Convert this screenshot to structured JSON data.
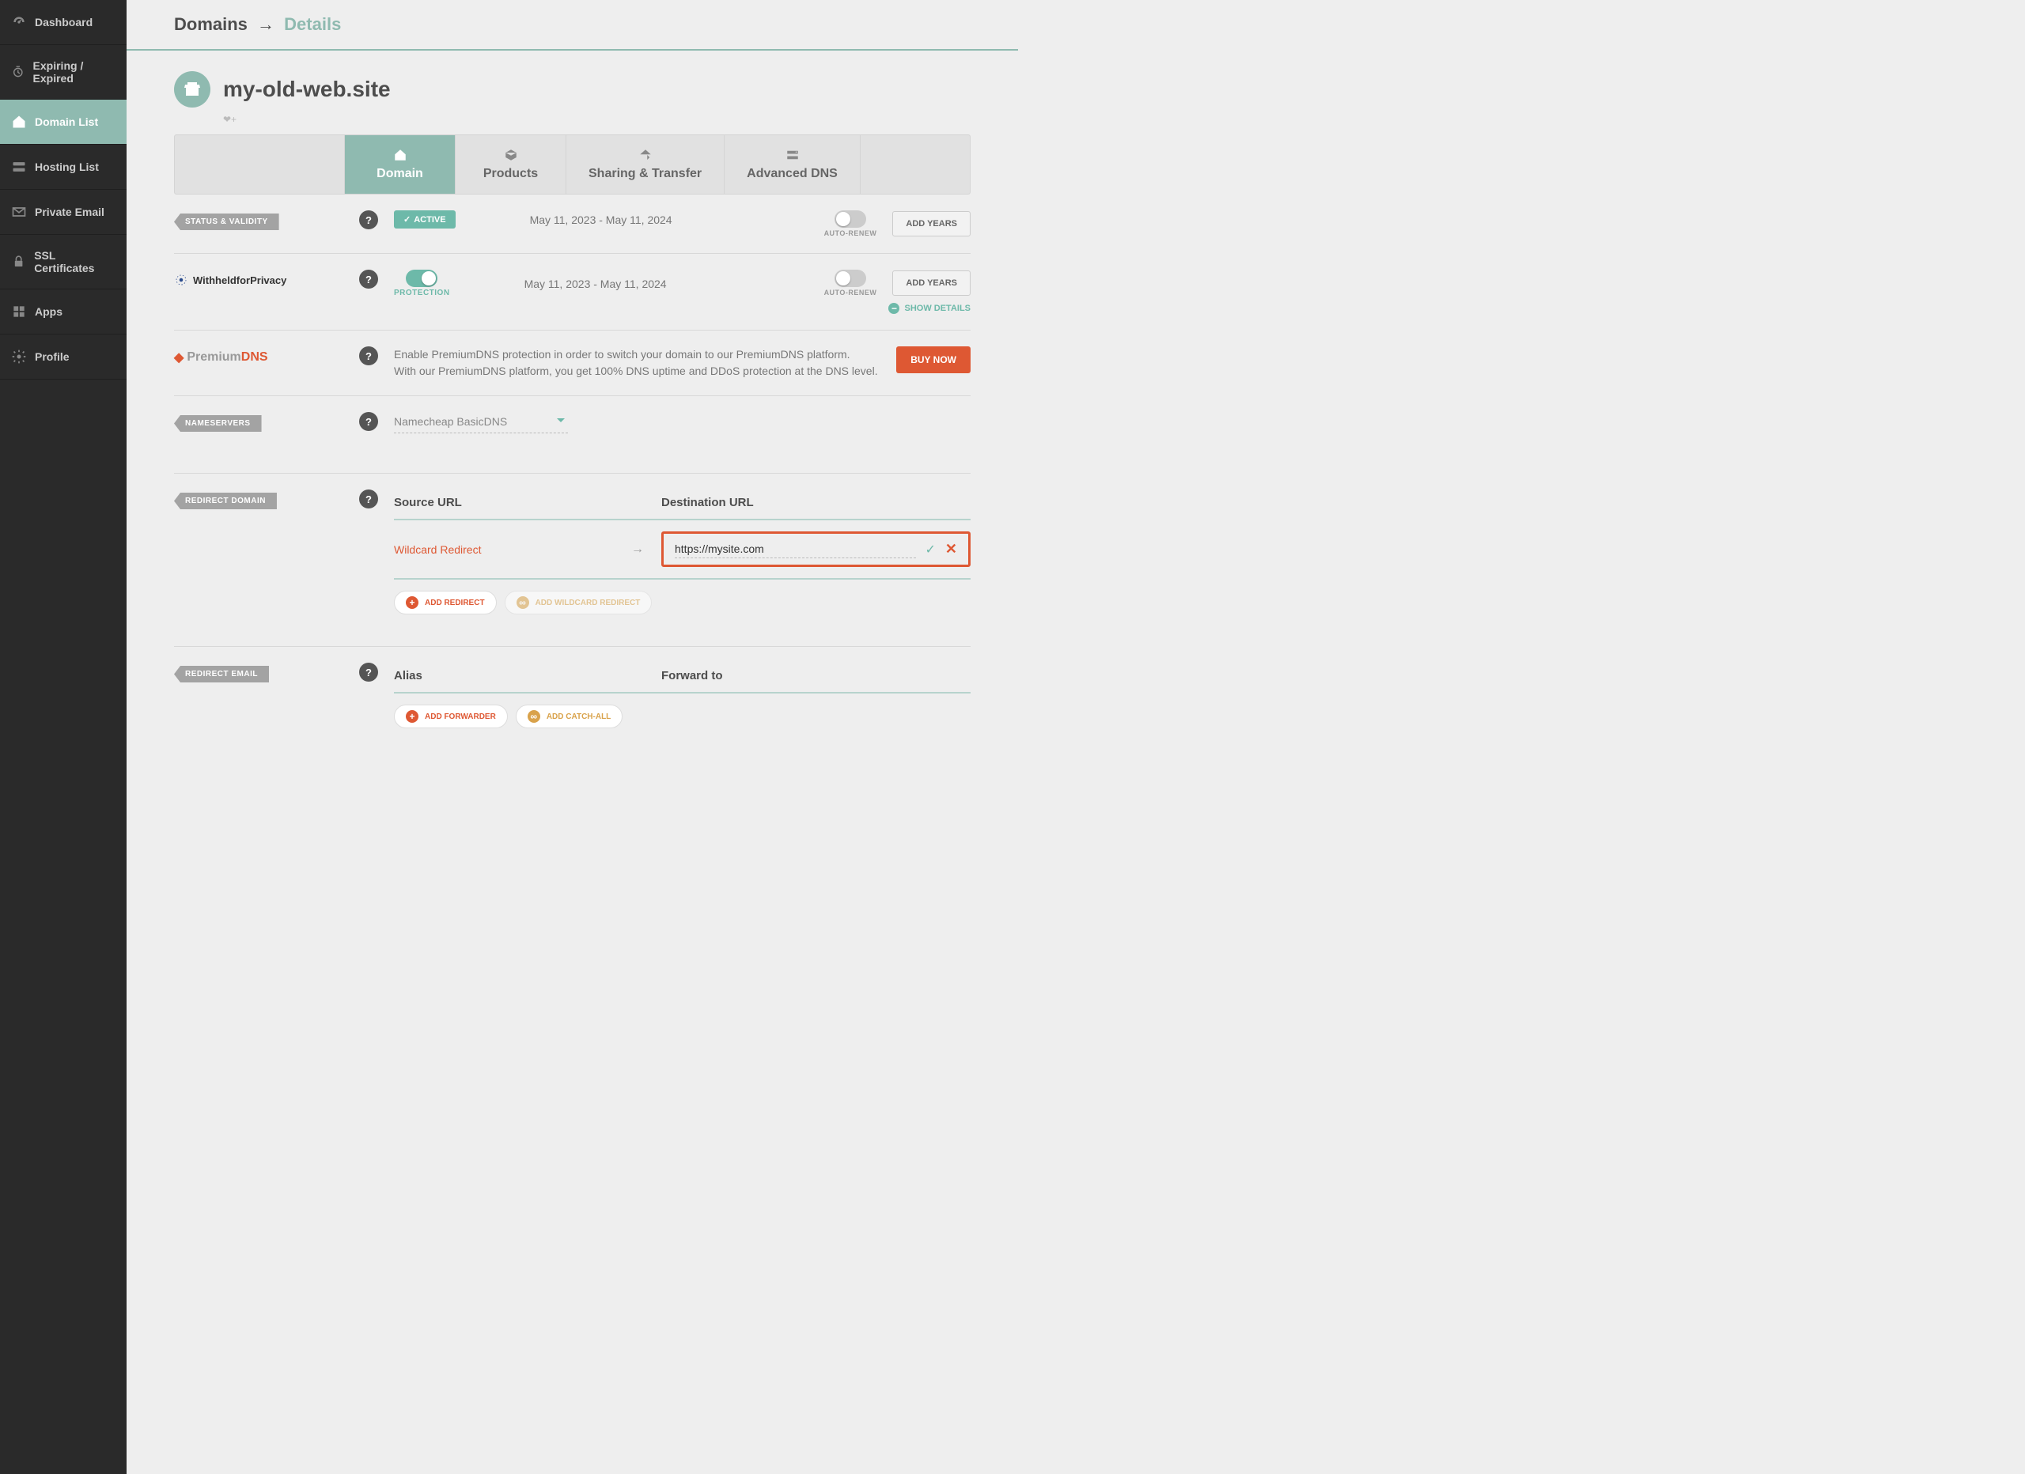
{
  "breadcrumb": {
    "root": "Domains",
    "current": "Details"
  },
  "sidebar": {
    "items": [
      {
        "label": "Dashboard"
      },
      {
        "label": "Expiring / Expired"
      },
      {
        "label": "Domain List"
      },
      {
        "label": "Hosting List"
      },
      {
        "label": "Private Email"
      },
      {
        "label": "SSL Certificates"
      },
      {
        "label": "Apps"
      },
      {
        "label": "Profile"
      }
    ]
  },
  "domain": {
    "name": "my-old-web.site"
  },
  "tabs": [
    {
      "label": "Domain"
    },
    {
      "label": "Products"
    },
    {
      "label": "Sharing & Transfer"
    },
    {
      "label": "Advanced DNS"
    }
  ],
  "status": {
    "section_label": "STATUS & VALIDITY",
    "badge": "ACTIVE",
    "dates": "May 11, 2023 - May 11, 2024",
    "auto_renew": "AUTO-RENEW",
    "add_years": "ADD YEARS"
  },
  "privacy": {
    "brand": "WithheldforPrivacy",
    "protection": "PROTECTION",
    "dates": "May 11, 2023 - May 11, 2024",
    "auto_renew": "AUTO-RENEW",
    "add_years": "ADD YEARS",
    "show_details": "SHOW DETAILS"
  },
  "premiumdns": {
    "prefix": "Premium",
    "suffix": "DNS",
    "desc1": "Enable PremiumDNS protection in order to switch your domain to our PremiumDNS platform.",
    "desc2": "With our PremiumDNS platform, you get 100% DNS uptime and DDoS protection at the DNS level.",
    "buy": "BUY NOW"
  },
  "nameservers": {
    "section_label": "NAMESERVERS",
    "value": "Namecheap BasicDNS"
  },
  "redirect_domain": {
    "section_label": "REDIRECT DOMAIN",
    "col_source": "Source URL",
    "col_dest": "Destination URL",
    "row_type": "Wildcard Redirect",
    "dest_value": "https://mysite.com",
    "add_redirect": "ADD REDIRECT",
    "add_wildcard": "ADD WILDCARD REDIRECT"
  },
  "redirect_email": {
    "section_label": "REDIRECT EMAIL",
    "col_alias": "Alias",
    "col_forward": "Forward to",
    "add_forwarder": "ADD FORWARDER",
    "add_catchall": "ADD CATCH-ALL"
  }
}
